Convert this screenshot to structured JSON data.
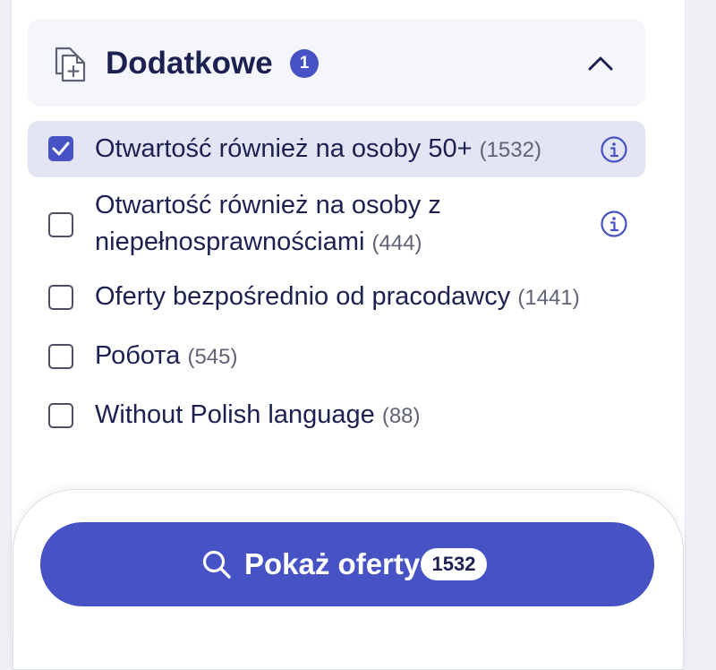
{
  "section": {
    "title": "Dodatkowe",
    "selected_count": "1",
    "icon": "document-plus-icon",
    "toggle_icon": "chevron-up-icon"
  },
  "options": [
    {
      "label": "Otwartość również na osoby 50+",
      "count": "(1532)",
      "checked": true,
      "has_info": true
    },
    {
      "label_line1": "Otwartość również na osoby z",
      "label_line2": "niepełnosprawnościami",
      "count": "(444)",
      "checked": false,
      "has_info": true
    },
    {
      "label": "Oferty bezpośrednio od pracodawcy",
      "count": "(1441)",
      "checked": false,
      "has_info": false
    },
    {
      "label": "Робота",
      "count": "(545)",
      "checked": false,
      "has_info": false
    },
    {
      "label": "Without Polish language",
      "count": "(88)",
      "checked": false,
      "has_info": false
    }
  ],
  "show_button": {
    "label": "Pokaż oferty",
    "count": "1532",
    "icon": "search-icon"
  },
  "colors": {
    "accent": "#4752c4",
    "text": "#1c2151",
    "muted": "#5f6375",
    "selected_row": "#e3e5f5",
    "header_bg": "#f5f6fb"
  }
}
